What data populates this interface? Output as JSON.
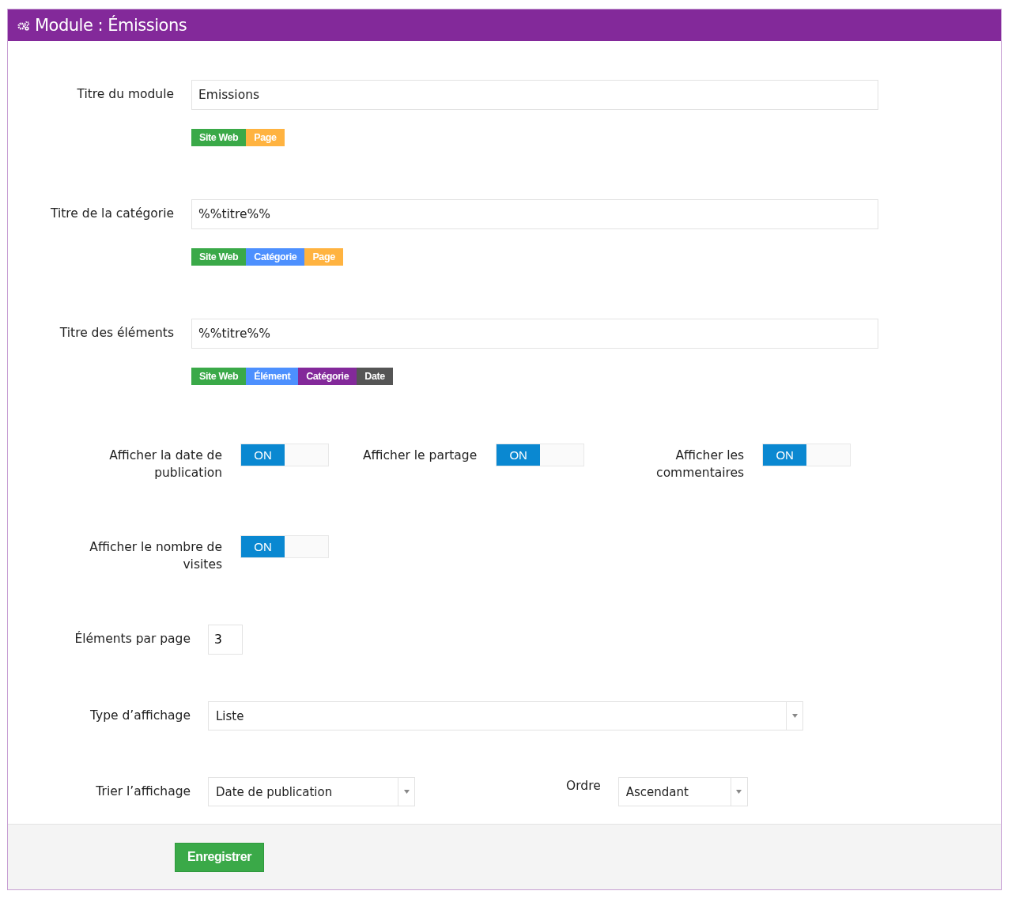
{
  "panel": {
    "title": "Module : Émissions"
  },
  "text_fields": [
    {
      "label": "Titre du module",
      "value": "Emissions",
      "tags": [
        {
          "text": "Site Web",
          "color": "#3aa948"
        },
        {
          "text": "Page",
          "color": "#ffb340"
        }
      ]
    },
    {
      "label": "Titre de la catégorie",
      "value": "%%titre%%",
      "tags": [
        {
          "text": "Site Web",
          "color": "#3aa948"
        },
        {
          "text": "Catégorie",
          "color": "#4d90fe"
        },
        {
          "text": "Page",
          "color": "#ffb340"
        }
      ]
    },
    {
      "label": "Titre des éléments",
      "value": "%%titre%%",
      "tags": [
        {
          "text": "Site Web",
          "color": "#3aa948"
        },
        {
          "text": "Élément",
          "color": "#4d90fe"
        },
        {
          "text": "Catégorie",
          "color": "#83299a"
        },
        {
          "text": "Date",
          "color": "#555555"
        }
      ]
    }
  ],
  "toggle_rows": [
    {
      "items": [
        {
          "label": "Afficher la date de publication",
          "on": true,
          "state_label": "ON"
        },
        {
          "label": "Afficher le partage",
          "on": true,
          "state_label": "ON"
        },
        {
          "label": "Afficher les commentaires",
          "on": true,
          "state_label": "ON"
        }
      ]
    },
    {
      "items": [
        {
          "label": "Afficher le nombre de visites",
          "on": true,
          "state_label": "ON"
        }
      ]
    }
  ],
  "per_page": {
    "label": "Éléments par page",
    "value": "3"
  },
  "display_type": {
    "label": "Type d’affichage",
    "value": "Liste"
  },
  "sort": {
    "label": "Trier l’affichage",
    "value": "Date de publication"
  },
  "order": {
    "label": "Ordre",
    "value": "Ascendant"
  },
  "save_button": "Enregistrer"
}
